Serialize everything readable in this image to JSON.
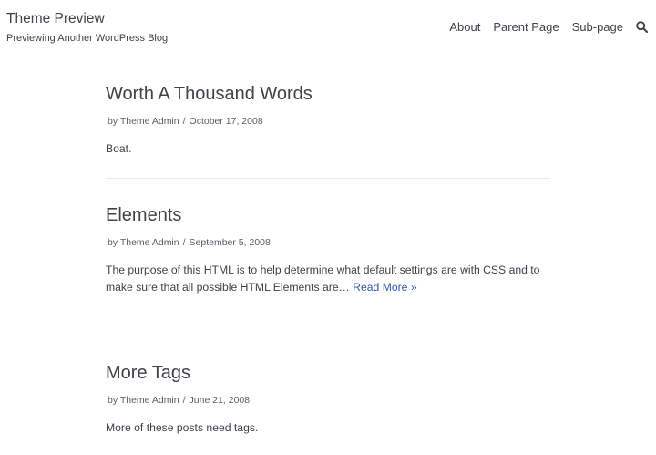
{
  "site": {
    "title": "Theme Preview",
    "tagline": "Previewing Another WordPress Blog"
  },
  "nav": {
    "items": [
      "About",
      "Parent Page",
      "Sub-page"
    ],
    "search_icon": "search-icon"
  },
  "posts": [
    {
      "title": "Worth A Thousand Words",
      "author_prefix": "by",
      "author": "Theme Admin",
      "separator": "/",
      "date": "October 17, 2008",
      "excerpt": "Boat.",
      "read_more": ""
    },
    {
      "title": "Elements",
      "author_prefix": "by",
      "author": "Theme Admin",
      "separator": "/",
      "date": "September 5, 2008",
      "excerpt": "The purpose of this HTML is to help determine what default settings are with CSS and to make sure that all possible HTML Elements are…",
      "read_more": "Read More »"
    },
    {
      "title": "More Tags",
      "author_prefix": "by",
      "author": "Theme Admin",
      "separator": "/",
      "date": "June 21, 2008",
      "excerpt": "More of these posts need tags.",
      "read_more": ""
    }
  ],
  "colors": {
    "text": "#404248",
    "meta": "#595d64",
    "link": "#2f5aae",
    "divider": "#ececec"
  }
}
